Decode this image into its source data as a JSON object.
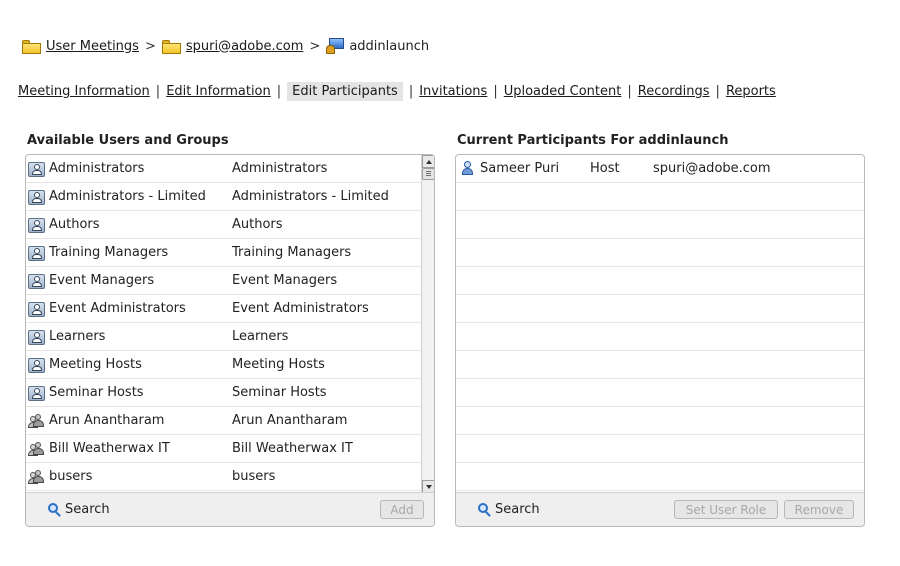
{
  "breadcrumb": [
    {
      "label": "User Meetings",
      "icon": "folder-icon",
      "link": true
    },
    {
      "label": "spuri@adobe.com",
      "icon": "folder-icon",
      "link": true
    },
    {
      "label": "addinlaunch",
      "icon": "meeting-icon",
      "link": false
    }
  ],
  "breadcrumb_separator": ">",
  "tabs": [
    {
      "label": "Meeting Information",
      "active": false
    },
    {
      "label": "Edit Information",
      "active": false
    },
    {
      "label": "Edit Participants",
      "active": true
    },
    {
      "label": "Invitations",
      "active": false
    },
    {
      "label": "Uploaded Content",
      "active": false
    },
    {
      "label": "Recordings",
      "active": false
    },
    {
      "label": "Reports",
      "active": false
    }
  ],
  "tab_separator": "|",
  "available": {
    "title": "Available Users and Groups",
    "rows": [
      {
        "type": "group",
        "name": "Administrators",
        "info": "Administrators"
      },
      {
        "type": "group",
        "name": "Administrators - Limited",
        "info": "Administrators - Limited"
      },
      {
        "type": "group",
        "name": "Authors",
        "info": "Authors"
      },
      {
        "type": "group",
        "name": "Training Managers",
        "info": "Training Managers"
      },
      {
        "type": "group",
        "name": "Event Managers",
        "info": "Event Managers"
      },
      {
        "type": "group",
        "name": "Event Administrators",
        "info": "Event Administrators"
      },
      {
        "type": "group",
        "name": "Learners",
        "info": "Learners"
      },
      {
        "type": "group",
        "name": "Meeting Hosts",
        "info": "Meeting Hosts"
      },
      {
        "type": "group",
        "name": "Seminar Hosts",
        "info": "Seminar Hosts"
      },
      {
        "type": "user",
        "name": "Arun Anantharam",
        "info": "Arun Anantharam"
      },
      {
        "type": "user",
        "name": "Bill Weatherwax IT",
        "info": "Bill Weatherwax IT"
      },
      {
        "type": "user",
        "name": "busers",
        "info": "busers"
      }
    ],
    "search_label": "Search",
    "add_label": "Add"
  },
  "current": {
    "title": "Current Participants For addinlaunch",
    "rows": [
      {
        "type": "host",
        "name": "Sameer Puri",
        "role": "Host",
        "email": "spuri@adobe.com"
      }
    ],
    "empty_rows": 11,
    "search_label": "Search",
    "set_role_label": "Set User Role",
    "remove_label": "Remove"
  },
  "colors": {
    "active_tab_bg": "#e4e4e4",
    "footer_bg": "#efefef",
    "disabled_text": "#a8a8a8",
    "folder_yellow": "#f3c22a",
    "search_blue": "#2d6fc7"
  }
}
